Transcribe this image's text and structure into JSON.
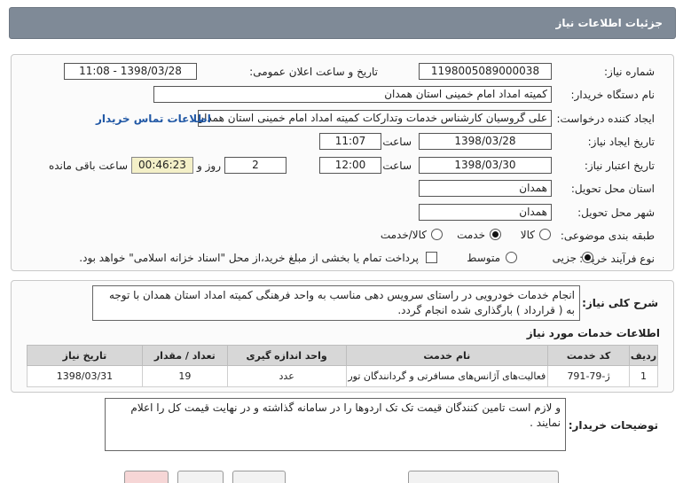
{
  "header": {
    "title": "جزئیات اطلاعات نیاز"
  },
  "form": {
    "need_number_label": "شماره نیاز:",
    "need_number": "1198005089000038",
    "announce_label": "تاریخ و ساعت اعلان عمومی:",
    "announce_value": "1398/03/28 - 11:08",
    "buyer_org_label": "نام دستگاه خریدار:",
    "buyer_org": "کمیته امداد امام خمینی استان همدان",
    "requester_label": "ایجاد کننده درخواست:",
    "requester": "علی گروسیان کارشناس خدمات وتدارکات کمیته امداد امام خمینی استان همدان",
    "contact_link": "اطلاعات تماس خریدار",
    "created_label": "تاریخ ایجاد نیاز:",
    "created_date": "1398/03/28",
    "time_label": "ساعت",
    "created_time": "11:07",
    "validity_label": "تاریخ اعتبار نیاز:",
    "validity_date": "1398/03/30",
    "validity_time": "12:00",
    "days_value": "2",
    "days_label": "روز و",
    "remaining_time": "00:46:23",
    "remaining_label": "ساعت باقی مانده",
    "province_label": "استان محل تحویل:",
    "province": "همدان",
    "city_label": "شهر محل تحویل:",
    "city": "همدان",
    "category_label": "طبقه بندی موضوعی:",
    "category_options": [
      "کالا",
      "خدمت",
      "کالا/خدمت"
    ],
    "purchase_type_label": "نوع فرآیند خرید :",
    "purchase_options": [
      "جزیی",
      "متوسط"
    ],
    "treasury_note": "پرداخت تمام یا بخشی از مبلغ خرید،از محل \"اسناد خزانه اسلامی\" خواهد بود."
  },
  "summary": {
    "label": "شرح کلی نیاز:",
    "text": "انجام خدمات خودرویی در راستای سرویس دهی مناسب به واحد فرهنگی کمیته امداد استان همدان با توجه به ( قرارداد ) بارگذاری شده انجام گردد."
  },
  "services": {
    "title": "اطلاعات خدمات مورد نیاز",
    "columns": [
      "ردیف",
      "کد خدمت",
      "نام خدمت",
      "واحد اندازه گیری",
      "تعداد / مقدار",
      "تاریخ نیاز"
    ],
    "rows": [
      [
        "1",
        "ژ-79-791",
        "فعالیت‌های آژانس‌های مسافرتی و گردانندگان تور",
        "عدد",
        "19",
        "1398/03/31"
      ]
    ]
  },
  "notes": {
    "label": "توضیحات خریدار:",
    "text": "و لازم است تامین کنندگان قیمت تک تک اردوها را در سامانه گذاشته و در نهایت قیمت کل را اعلام نمایند ."
  },
  "colors": {
    "header_bg": "#7f8a97",
    "link": "#2158a5",
    "highlight_bg": "#f4f0c8"
  }
}
